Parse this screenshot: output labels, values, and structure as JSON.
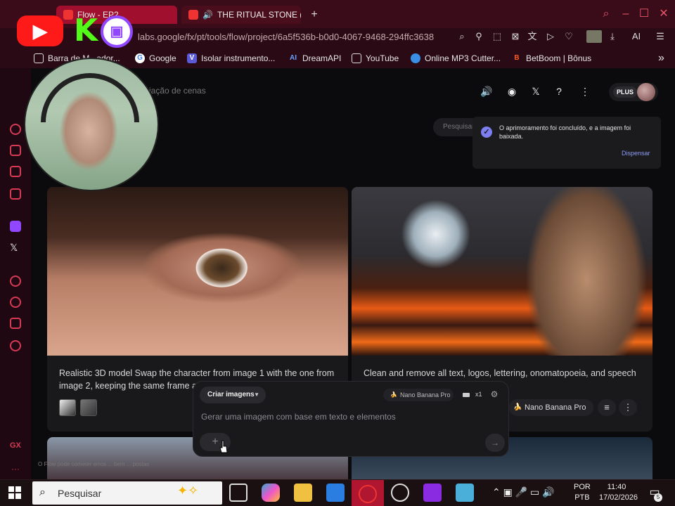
{
  "browser": {
    "tabs": [
      {
        "label": "Flow - EP2"
      },
      {
        "label": "THE RITUAL STONE (O"
      }
    ],
    "new_tab": "+",
    "url": "labs.google/fx/pt/tools/flow/project/6a5f536b-b0d0-4067-9468-294ffc3638",
    "ai_label": "AI",
    "bookmarks": [
      {
        "label": "Barra de M...ador...",
        "icon": "folder-icon"
      },
      {
        "label": "Google",
        "icon": "google-icon"
      },
      {
        "label": "Isolar instrumento...",
        "icon": "v-icon"
      },
      {
        "label": "DreamAPI",
        "icon": "ai-icon"
      },
      {
        "label": "YouTube",
        "icon": "page-icon"
      },
      {
        "label": "Online MP3 Cutter...",
        "icon": "mp3-icon"
      },
      {
        "label": "BetBoom | Bônus",
        "icon": "bb-icon"
      }
    ],
    "more_bookmarks": "»"
  },
  "page": {
    "breadcrumb": "iação de cenas",
    "plus_label": "PLUS",
    "search_placeholder": "Pesquisar",
    "toast": {
      "message": "O aprimoramento foi concluído, e a imagem foi baixada.",
      "dismiss": "Dispensar"
    },
    "cards": [
      {
        "text": "Realistic 3D model Swap the character from image 1 with the one from image 2, keeping the same frame ar"
      },
      {
        "text": "Clean and remove all text, logos, lettering, onomatopoeia, and speech ...aintain the exact composition an...",
        "model": "Nano Banana Pro"
      }
    ],
    "composer": {
      "mode": "Criar imagens",
      "model": "Nano Banana Pro",
      "count": "x1",
      "placeholder": "Gerar uma imagem com base em texto e elementos"
    },
    "bottom_note": "O Flow pode cometer erros ... bem ... postas"
  },
  "taskbar": {
    "search_placeholder": "Pesquisar",
    "lang": [
      "POR",
      "PTB"
    ],
    "time": "11:40",
    "date": "17/02/2026",
    "notifications": "5"
  },
  "colors": {
    "chrome": "#3a0b18",
    "accent": "#d63a55",
    "toast_link": "#8e9cf5"
  }
}
